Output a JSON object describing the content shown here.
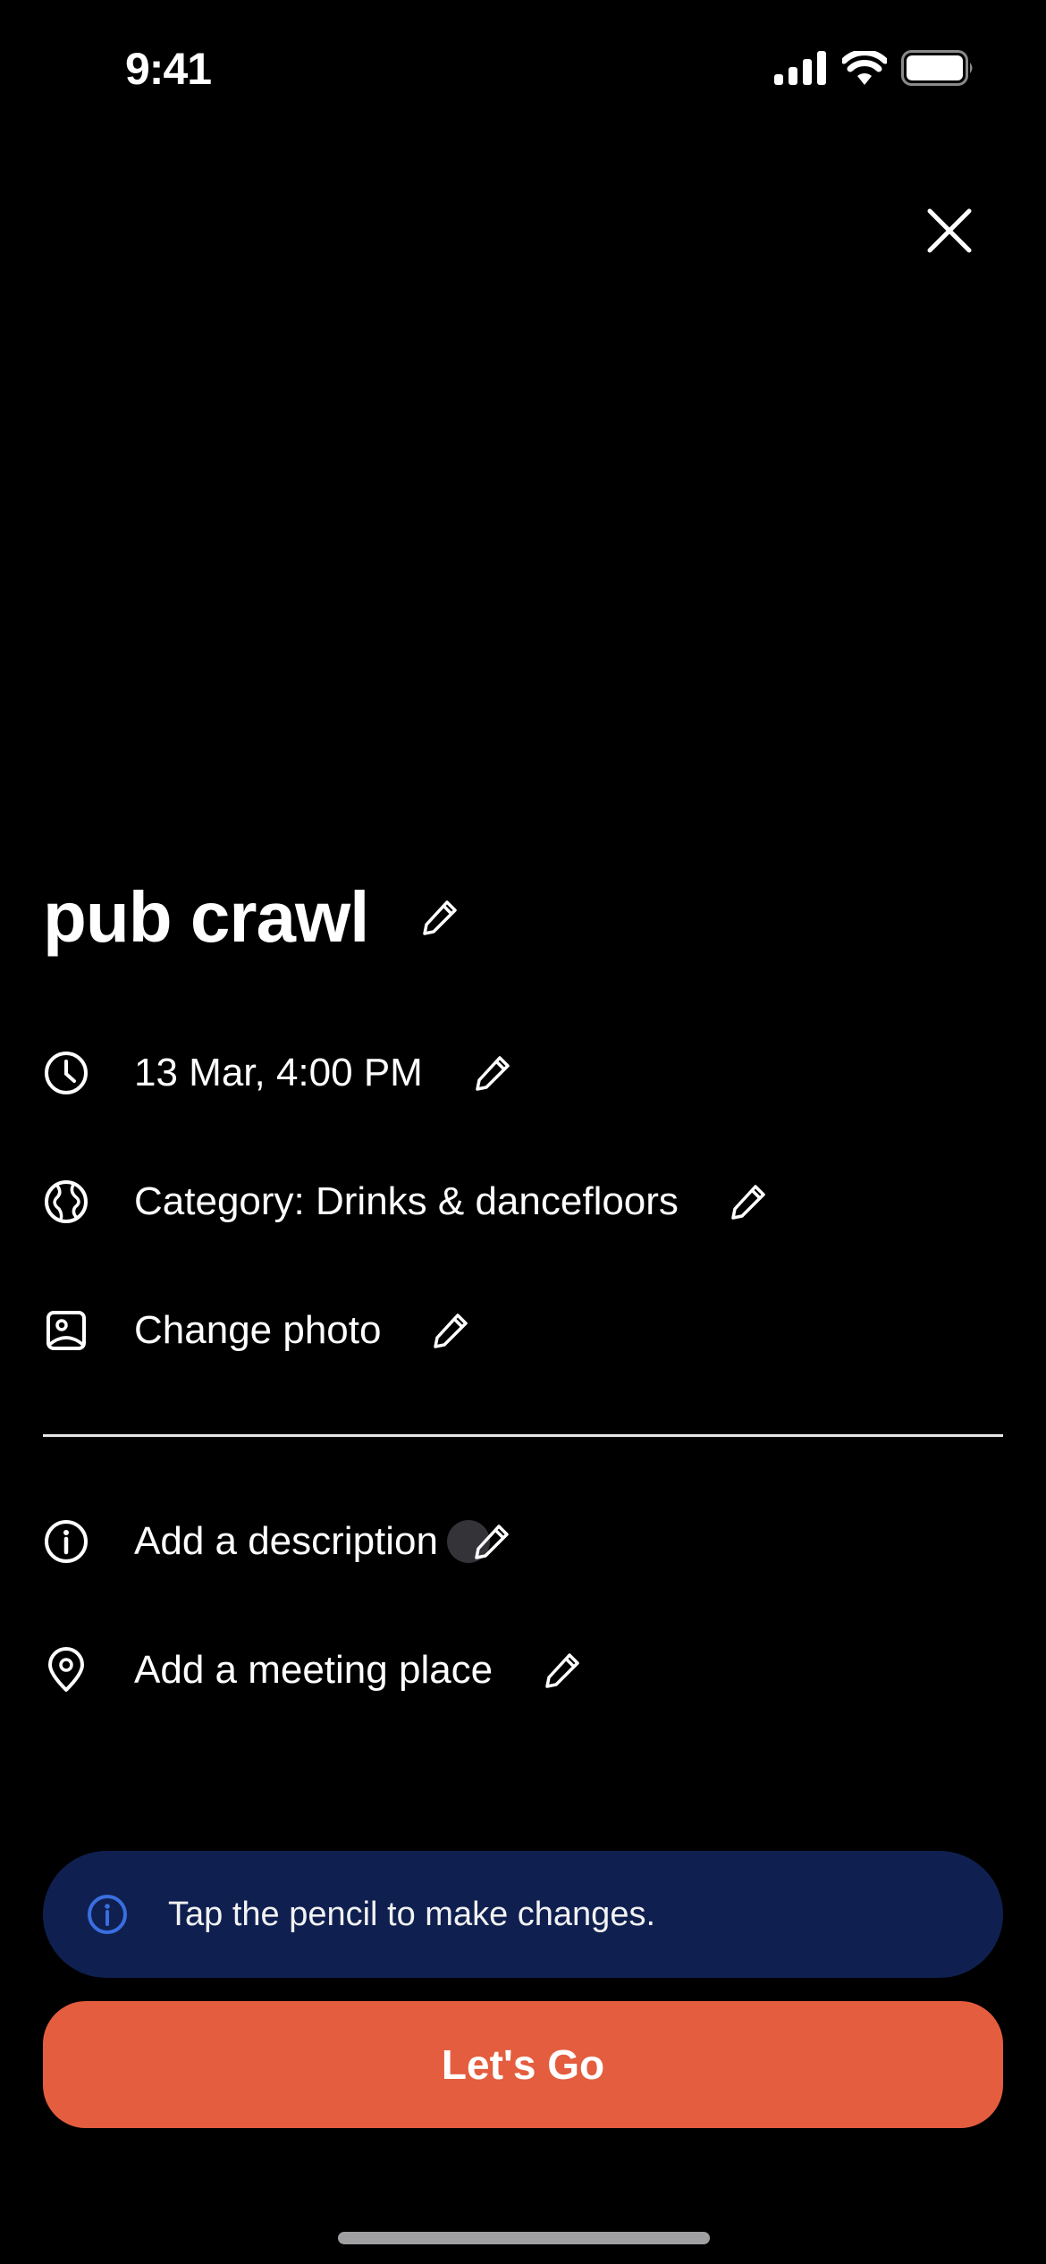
{
  "status_bar": {
    "time": "9:41",
    "icons": [
      "signal-icon",
      "wifi-icon",
      "battery-icon"
    ]
  },
  "header": {
    "close_icon": "close-icon"
  },
  "event": {
    "title": "pub crawl",
    "fields": [
      {
        "icon": "clock-icon",
        "label": "13 Mar, 4:00 PM"
      },
      {
        "icon": "globe-icon",
        "label": "Category: Drinks & dancefloors"
      },
      {
        "icon": "photo-icon",
        "label": "Change photo"
      }
    ],
    "optional_fields": [
      {
        "icon": "info-icon",
        "label": "Add a description"
      },
      {
        "icon": "location-pin-icon",
        "label": "Add a meeting place"
      }
    ]
  },
  "hint_banner": {
    "icon": "info-icon",
    "text": "Tap the pencil to make changes."
  },
  "primary_action": {
    "label": "Let's Go"
  },
  "colors": {
    "background": "#000000",
    "accent": "#e45d3f",
    "banner_bg": "#0f2050",
    "banner_icon": "#3a6ee0"
  }
}
